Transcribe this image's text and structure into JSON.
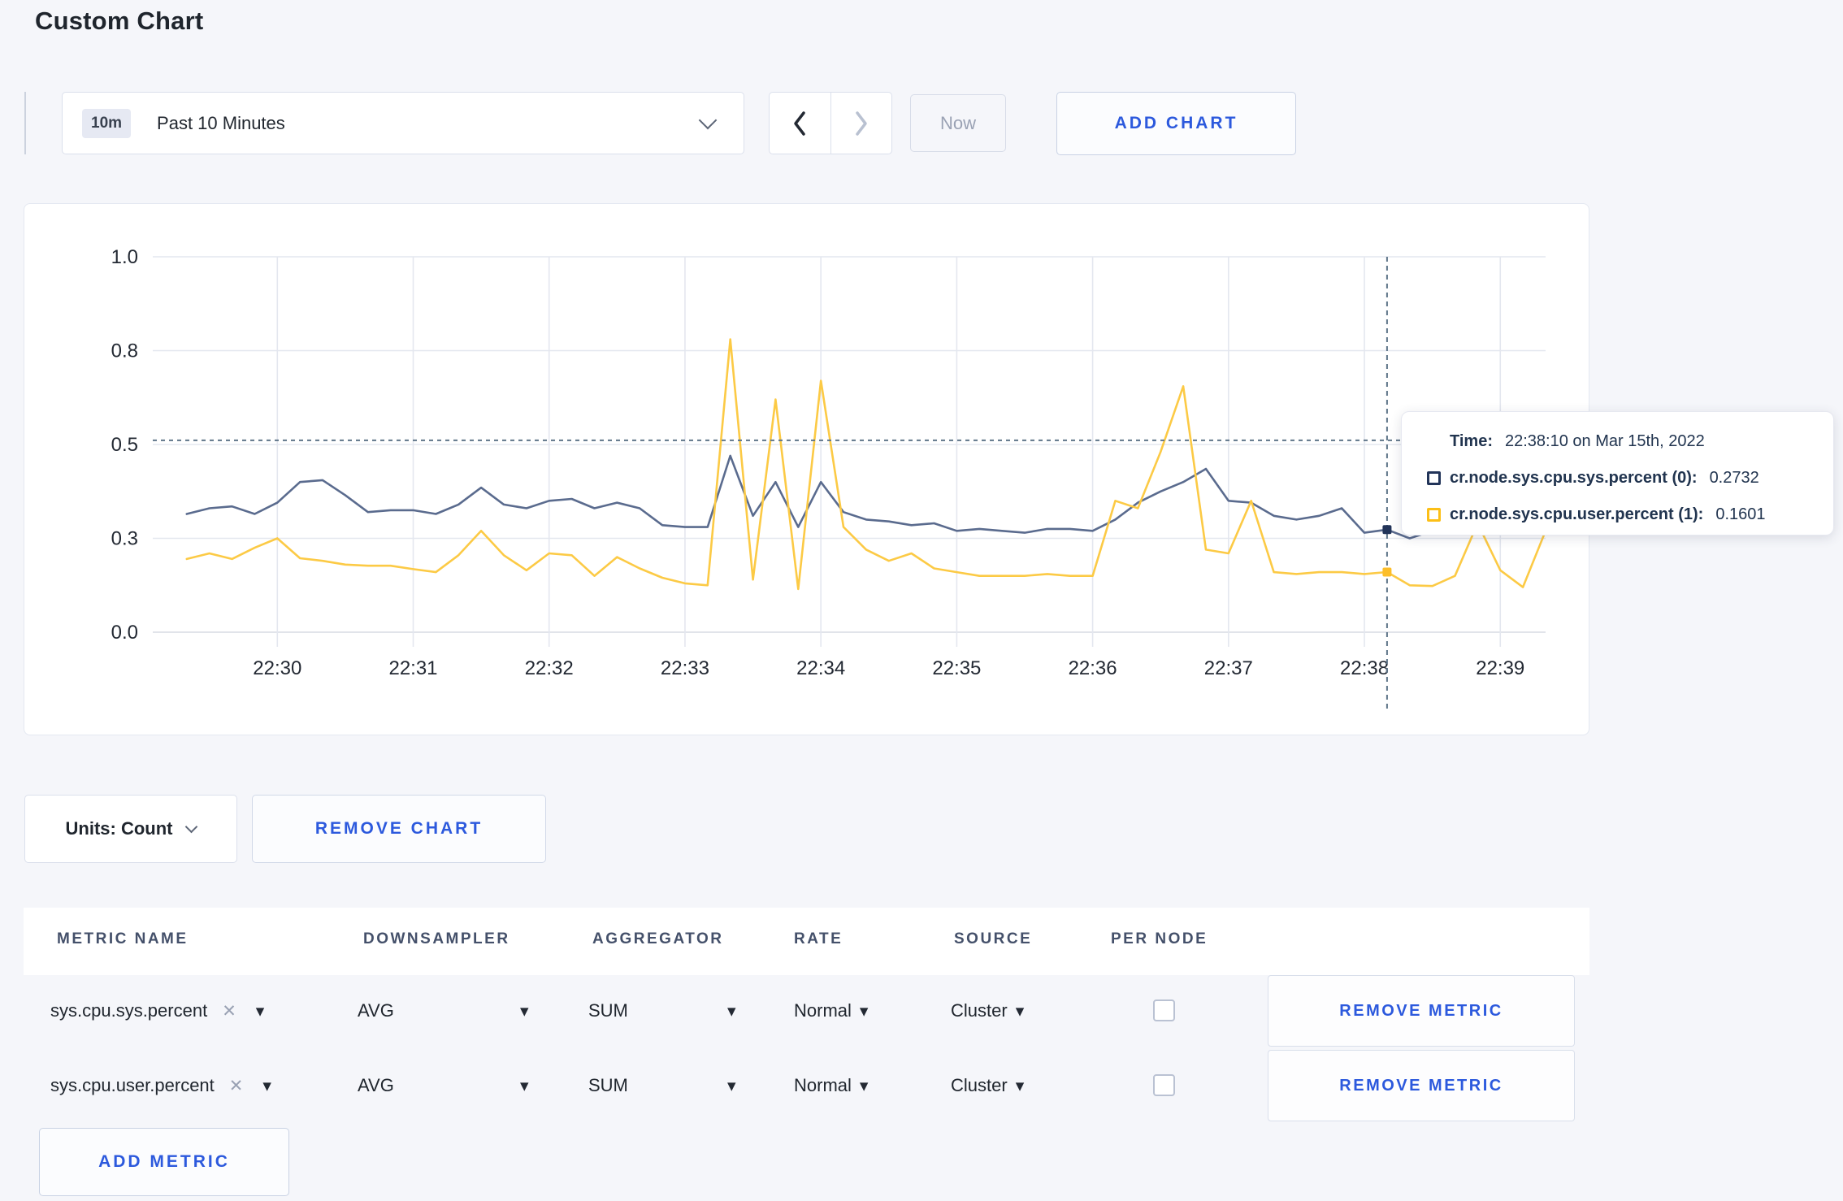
{
  "page": {
    "title": "Custom Chart"
  },
  "colors": {
    "accent_blue": "#2c59dd",
    "page_bg": "#f5f6fa",
    "series_sys": "#5a6b8e",
    "series_user": "#fcca45",
    "crosshair": "#5f7589"
  },
  "toolbar": {
    "range_badge": "10m",
    "range_label": "Past 10 Minutes",
    "now_label": "Now",
    "add_chart_label": "ADD CHART"
  },
  "icons": {
    "range_chevron": "chevron-down",
    "prev": "chevron-left",
    "next": "chevron-right",
    "metric_remove": "✕",
    "select_caret": "▾"
  },
  "chart_data": {
    "type": "line",
    "title": "",
    "xlabel": "",
    "ylabel": "",
    "ylim": [
      0,
      1
    ],
    "grid": true,
    "x_tick_labels": [
      "22:30",
      "22:31",
      "22:32",
      "22:33",
      "22:34",
      "22:35",
      "22:36",
      "22:37",
      "22:38",
      "22:39"
    ],
    "y_tick_labels": [
      "0.0",
      "0.3",
      "0.5",
      "0.8",
      "1.0"
    ],
    "y_tick_values": [
      0,
      0.25,
      0.5,
      0.75,
      1
    ],
    "sample_start": "22:29:20",
    "sample_interval_sec": 10,
    "series": [
      {
        "name": "cr.node.sys.cpu.sys.percent",
        "color": "#5a6b8e",
        "values": [
          0.315,
          0.33,
          0.335,
          0.315,
          0.345,
          0.4,
          0.405,
          0.365,
          0.32,
          0.325,
          0.325,
          0.315,
          0.34,
          0.385,
          0.34,
          0.33,
          0.35,
          0.355,
          0.33,
          0.345,
          0.33,
          0.285,
          0.28,
          0.28,
          0.47,
          0.31,
          0.4,
          0.28,
          0.4,
          0.32,
          0.3,
          0.295,
          0.285,
          0.29,
          0.27,
          0.275,
          0.27,
          0.265,
          0.275,
          0.275,
          0.27,
          0.3,
          0.345,
          0.375,
          0.4,
          0.435,
          0.35,
          0.345,
          0.31,
          0.3,
          0.31,
          0.33,
          0.265,
          0.2732,
          0.25,
          0.27,
          0.285,
          0.29,
          0.285,
          0.3,
          0.295
        ]
      },
      {
        "name": "cr.node.sys.cpu.user.percent",
        "color": "#fcca45",
        "values": [
          0.195,
          0.21,
          0.195,
          0.225,
          0.25,
          0.197,
          0.19,
          0.18,
          0.177,
          0.177,
          0.168,
          0.16,
          0.205,
          0.27,
          0.205,
          0.165,
          0.21,
          0.205,
          0.15,
          0.2,
          0.17,
          0.145,
          0.13,
          0.125,
          0.78,
          0.14,
          0.62,
          0.115,
          0.67,
          0.28,
          0.22,
          0.19,
          0.21,
          0.17,
          0.16,
          0.15,
          0.15,
          0.15,
          0.155,
          0.15,
          0.15,
          0.35,
          0.33,
          0.48,
          0.655,
          0.22,
          0.21,
          0.35,
          0.16,
          0.155,
          0.16,
          0.16,
          0.155,
          0.1601,
          0.125,
          0.123,
          0.15,
          0.29,
          0.165,
          0.12,
          0.27
        ]
      }
    ],
    "crosshair": {
      "time": "22:38:10",
      "values": [
        0.2732,
        0.1601
      ],
      "dot_colors": [
        "#223459",
        "#fcbe2b"
      ],
      "guide_value": 0.511,
      "color": "#5f7589"
    },
    "legend_position": "tooltip"
  },
  "tooltip": {
    "time_label": "Time:",
    "time_value": "22:38:10 on Mar 15th, 2022",
    "rows": [
      {
        "label": "cr.node.sys.cpu.sys.percent (0):",
        "value": "0.2732",
        "color": "#223459"
      },
      {
        "label": "cr.node.sys.cpu.user.percent (1):",
        "value": "0.1601",
        "color": "#fcbf17"
      }
    ]
  },
  "chart_controls": {
    "units_label": "Units: Count",
    "remove_chart_label": "REMOVE CHART"
  },
  "metrics_table": {
    "headers": [
      "METRIC NAME",
      "DOWNSAMPLER",
      "AGGREGATOR",
      "RATE",
      "SOURCE",
      "PER NODE"
    ],
    "rows": [
      {
        "metric": "sys.cpu.sys.percent",
        "downsampler": "AVG",
        "aggregator": "SUM",
        "rate": "Normal",
        "source": "Cluster",
        "per_node": false,
        "remove_label": "REMOVE METRIC"
      },
      {
        "metric": "sys.cpu.user.percent",
        "downsampler": "AVG",
        "aggregator": "SUM",
        "rate": "Normal",
        "source": "Cluster",
        "per_node": false,
        "remove_label": "REMOVE METRIC"
      }
    ],
    "add_metric_label": "ADD METRIC"
  }
}
